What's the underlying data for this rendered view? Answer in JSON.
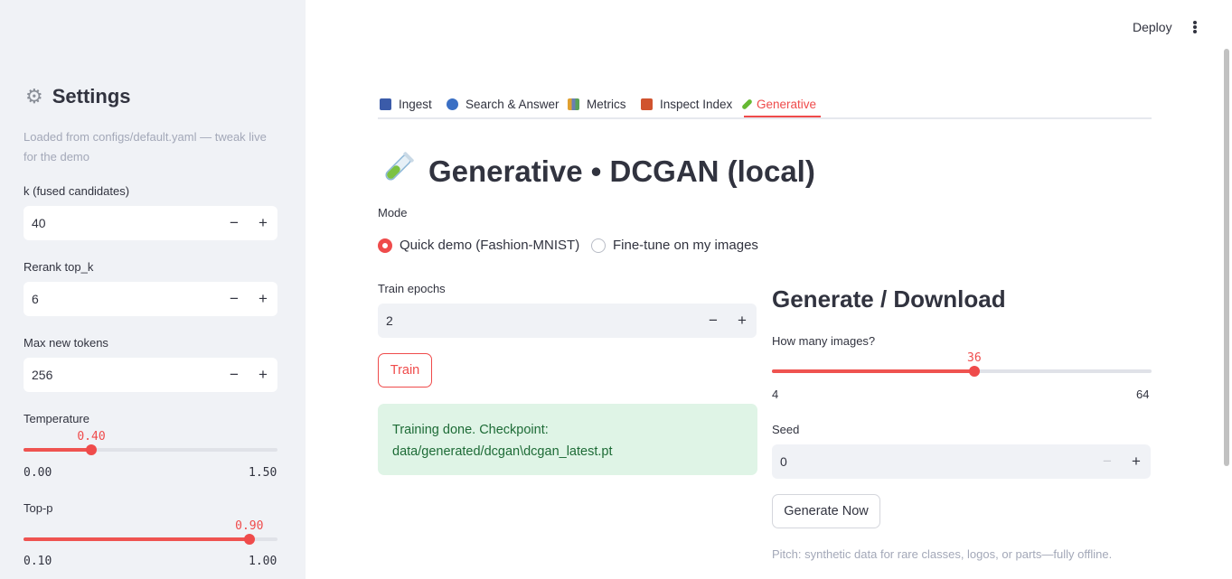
{
  "sidebar": {
    "title": "Settings",
    "caption": "Loaded from configs/default.yaml — tweak live for the demo",
    "k": {
      "label": "k (fused candidates)",
      "value": "40"
    },
    "rerank": {
      "label": "Rerank top_k",
      "value": "6"
    },
    "max_tokens": {
      "label": "Max new tokens",
      "value": "256"
    },
    "temperature": {
      "label": "Temperature",
      "value": "0.40",
      "min": "0.00",
      "max": "1.50",
      "fraction": 0.267
    },
    "top_p": {
      "label": "Top-p",
      "value": "0.90",
      "min": "0.10",
      "max": "1.00",
      "fraction": 0.889
    },
    "minus": "−",
    "plus": "+"
  },
  "header": {
    "deploy": "Deploy"
  },
  "tabs": [
    {
      "label": "Ingest",
      "icon": "inbox-tray-icon",
      "color": "#3b5ba9"
    },
    {
      "label": "Search & Answer",
      "icon": "magnifier-icon",
      "color": "#3a6fc4"
    },
    {
      "label": "Metrics",
      "icon": "bar-chart-icon",
      "color": "#6b7fb3"
    },
    {
      "label": "Inspect Index",
      "icon": "brick-icon",
      "color": "#d0532e"
    },
    {
      "label": "Generative",
      "icon": "test-tube-icon",
      "color": "#66b933"
    }
  ],
  "page": {
    "title": "Generative • DCGAN (local)",
    "mode_label": "Mode",
    "modes": [
      "Quick demo (Fashion-MNIST)",
      "Fine-tune on my images"
    ],
    "selected_mode": 0,
    "epochs": {
      "label": "Train epochs",
      "value": "2"
    },
    "train_button": "Train",
    "success_message": "Training done. Checkpoint: data/generated/dcgan\\dcgan_latest.pt",
    "generate": {
      "heading": "Generate / Download",
      "count_label": "How many images?",
      "count_value": "36",
      "count_min": "4",
      "count_max": "64",
      "count_fraction": 0.533,
      "seed_label": "Seed",
      "seed_value": "0",
      "button": "Generate Now",
      "pitch": "Pitch: synthetic data for rare classes, logos, or parts—fully offline."
    }
  },
  "colors": {
    "accent": "#ef4b4b",
    "sidebar_bg": "#f0f2f6",
    "success_bg": "#dff4e6",
    "success_text": "#1d6b36"
  }
}
